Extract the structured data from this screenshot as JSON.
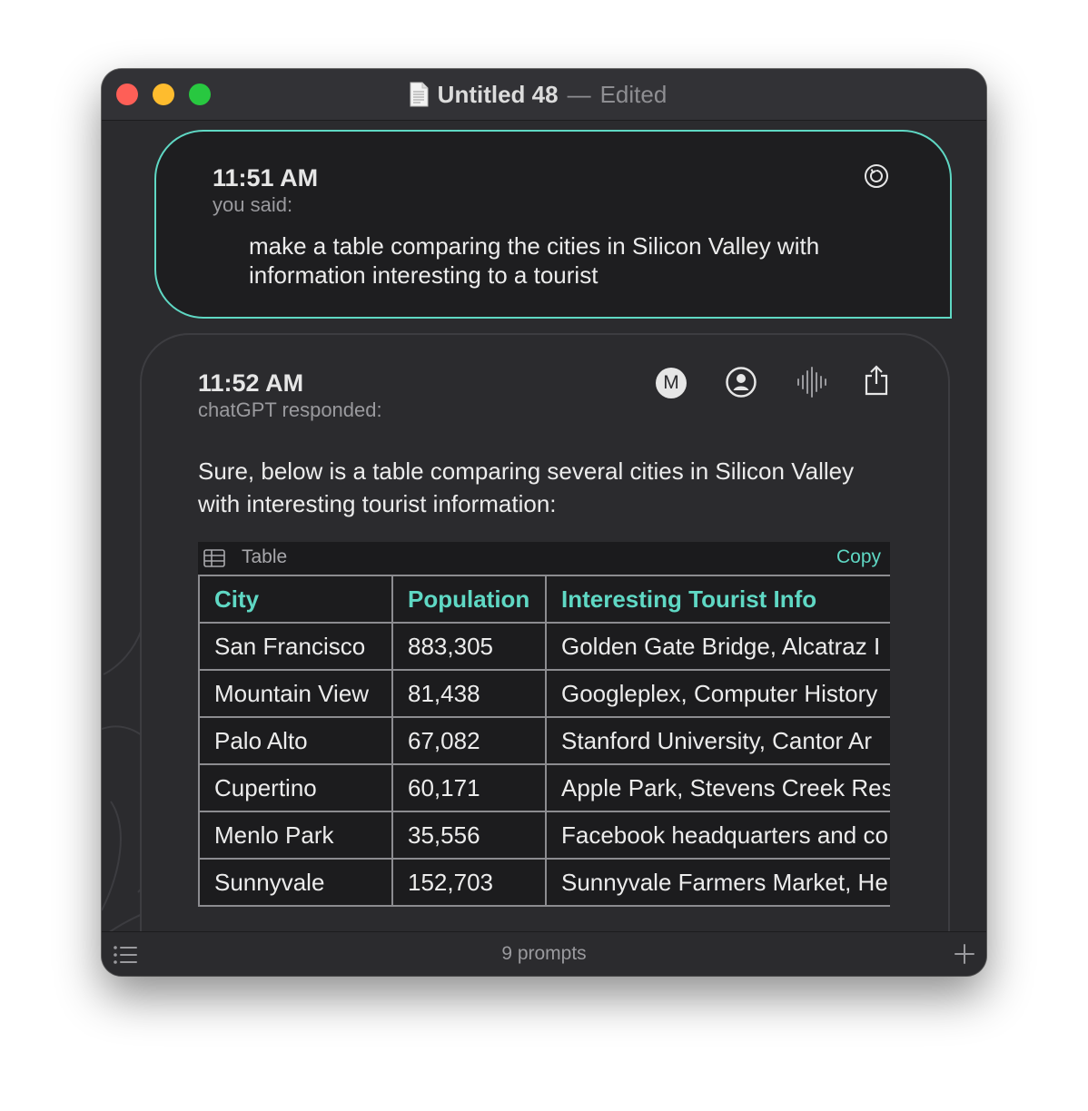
{
  "window": {
    "title": "Untitled 48",
    "separator": "—",
    "status": "Edited"
  },
  "prompt": {
    "time": "11:51 AM",
    "speaker": "you said:",
    "text": "make a table comparing the cities in Silicon Valley with information interesting to a tourist"
  },
  "response": {
    "time": "11:52 AM",
    "speaker": "chatGPT responded:",
    "model_badge": "M",
    "text": "Sure, below is a table comparing several cities in Silicon Valley with interesting tourist information:",
    "table": {
      "label": "Table",
      "copy_label": "Copy",
      "headers": [
        "City",
        "Population",
        "Interesting Tourist Info"
      ],
      "rows": [
        [
          "San Francisco",
          "883,305",
          "Golden Gate Bridge, Alcatraz I"
        ],
        [
          "Mountain View",
          "81,438",
          "Googleplex, Computer History"
        ],
        [
          "Palo Alto",
          "67,082",
          "Stanford University, Cantor Ar"
        ],
        [
          "Cupertino",
          "60,171",
          "Apple Park, Stevens Creek Res"
        ],
        [
          "Menlo Park",
          "35,556",
          "Facebook headquarters and co"
        ],
        [
          "Sunnyvale",
          "152,703",
          "Sunnyvale Farmers Market, He"
        ]
      ]
    }
  },
  "footer": {
    "prompt_count": "9 prompts"
  },
  "icons": {
    "redo": "redo-icon",
    "user": "user-circle-icon",
    "voice": "waveform-icon",
    "share": "share-icon",
    "table": "table-icon",
    "list": "list-icon",
    "add": "plus-icon"
  },
  "colors": {
    "accent": "#5fd8c4",
    "background": "#2b2b2e",
    "card": "#1e1e20"
  }
}
